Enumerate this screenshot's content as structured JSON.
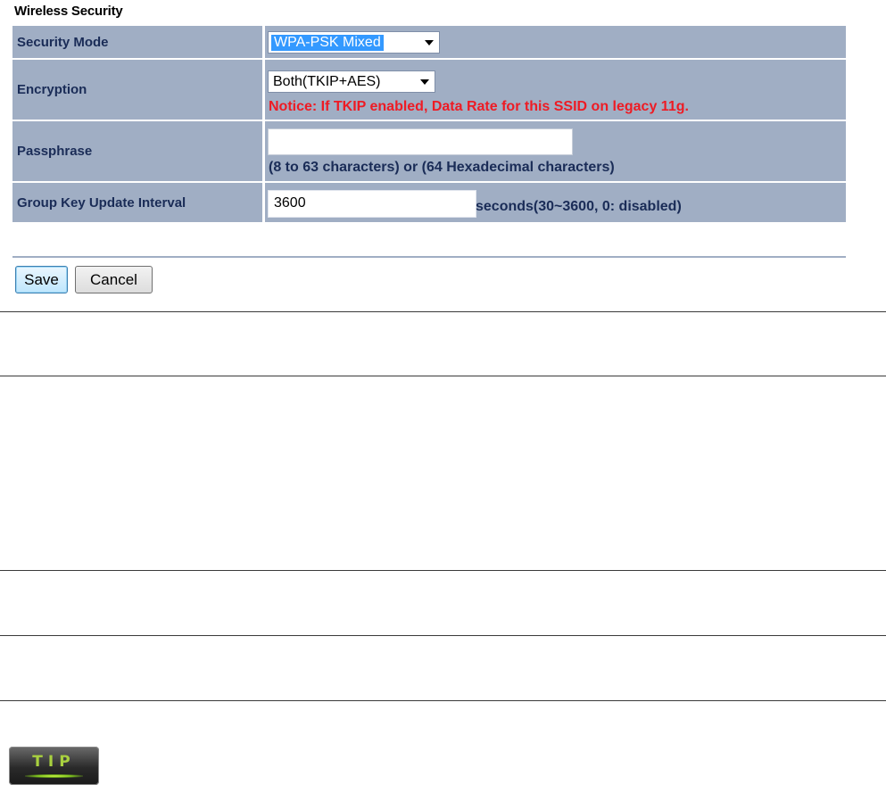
{
  "section_title": "Wireless Security",
  "rows": {
    "security_mode": {
      "label": "Security Mode",
      "selected": "WPA-PSK Mixed"
    },
    "encryption": {
      "label": "Encryption",
      "selected": "Both(TKIP+AES)",
      "notice": "Notice: If TKIP enabled, Data Rate for this SSID on legacy 11g."
    },
    "passphrase": {
      "label": "Passphrase",
      "value": "",
      "hint": "(8 to 63 characters) or (64 Hexadecimal characters)"
    },
    "group_key": {
      "label": "Group Key Update Interval",
      "value": "3600",
      "unit_hint": "seconds(30~3600, 0: disabled)"
    }
  },
  "buttons": {
    "save": "Save",
    "cancel": "Cancel"
  },
  "tip_badge": {
    "text": "TIP",
    "icon": "tip-badge-icon"
  },
  "colors": {
    "row_bg": "#a0aec4",
    "label_text": "#1a2c57",
    "notice_text": "#ee1b24",
    "highlight": "#3399ff"
  }
}
